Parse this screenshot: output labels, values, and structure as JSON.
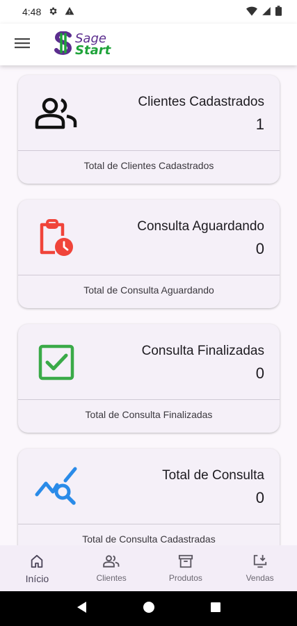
{
  "status_bar": {
    "time": "4:48"
  },
  "app_bar": {
    "logo_top": "Sage",
    "logo_bottom": "Start"
  },
  "cards": [
    {
      "title": "Clientes Cadastrados",
      "value": "1",
      "footer": "Total de Clientes Cadastrados",
      "icon": "people-icon",
      "color": "#111111"
    },
    {
      "title": "Consulta Aguardando",
      "value": "0",
      "footer": "Total de Consulta Aguardando",
      "icon": "clipboard-clock-icon",
      "color": "#f0443a"
    },
    {
      "title": "Consulta Finalizadas",
      "value": "0",
      "footer": "Total de Consulta Finalizadas",
      "icon": "checkbox-icon",
      "color": "#3aaa48"
    },
    {
      "title": "Total de Consulta",
      "value": "0",
      "footer": "Total de Consulta Cadastradas",
      "icon": "chart-search-icon",
      "color": "#2a8be8"
    }
  ],
  "bottom_nav": [
    {
      "label": "Início",
      "icon": "home-icon",
      "active": true
    },
    {
      "label": "Clientes",
      "icon": "people-icon",
      "active": false
    },
    {
      "label": "Produtos",
      "icon": "archive-box-icon",
      "active": false
    },
    {
      "label": "Vendas",
      "icon": "download-monitor-icon",
      "active": false
    }
  ]
}
